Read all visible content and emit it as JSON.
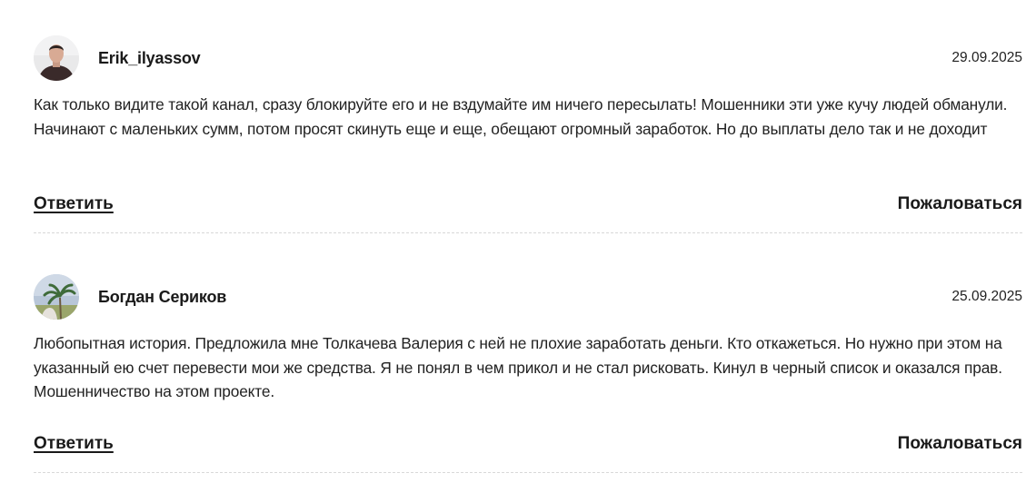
{
  "comments": [
    {
      "author": "Erik_ilyassov",
      "date": "29.09.2025",
      "avatar_icon": "user-photo-man-dark-shirt",
      "text": "Как только видите такой канал, сразу блокируйте его и не вздумайте им ничего пересылать! Мошенники эти уже кучу людей обманули. Начинают с маленьких сумм, потом просят скинуть еще и еще, обещают огромный заработок. Но до выплаты дело так и не доходит",
      "reply_label": "Ответить",
      "complain_label": "Пожаловаться"
    },
    {
      "author": "Богдан Сериков",
      "date": "25.09.2025",
      "avatar_icon": "user-photo-palm-tree-sky",
      "text": "Любопытная история. Предложила мне Толкачева Валерия с ней не плохие заработать деньги. Кто откажеться. Но нужно при этом на указанный ею счет перевести мои же средства. Я не понял в чем прикол и не стал рисковать. Кинул в черный список и оказался прав. Мошенничество на этом проекте.",
      "reply_label": "Ответить",
      "complain_label": "Пожаловаться"
    }
  ]
}
